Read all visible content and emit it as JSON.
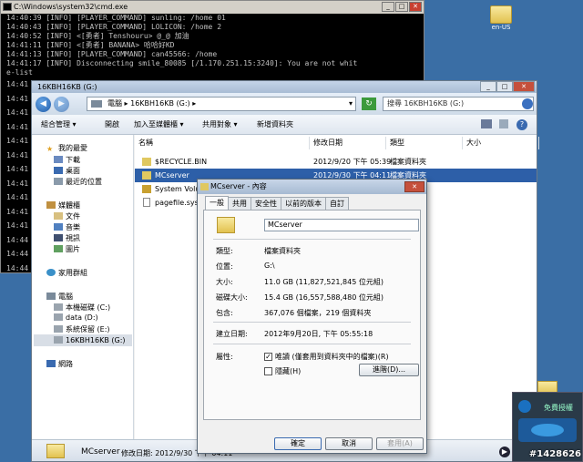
{
  "console": {
    "title": "C:\\Windows\\system32\\cmd.exe",
    "lines": [
      "14:40:39 [INFO] [PLAYER_COMMAND] sunling: /home 01",
      "14:40:43 [INFO] [PLAYER_COMMAND] LOLICON: /home 2",
      "14:40:52 [INFO] <[勇者] Tenshouru> @_@  加油",
      "14:41:11 [INFO] <[勇者] BANANA> 哈哈好KD",
      "14:41:13 [INFO] [PLAYER_COMMAND] can45566: /home",
      "14:41:17 [INFO] Disconnecting smile_80085 [/1.170.251.15:3240]: You are not whit",
      "e-list"
    ],
    "side_lines": [
      "14:41",
      "14:41",
      "14:41",
      "14:41",
      "14:41",
      "14:41",
      "14:41",
      "14:41",
      "14:41",
      "14:41",
      "14:41",
      "14:44",
      "14:44",
      "14:44"
    ]
  },
  "desktop": {
    "icon_label": "en-US"
  },
  "explorer": {
    "title": "16KBH16KB (G:)",
    "address": [
      "電腦",
      "16KBH16KB (G:)"
    ],
    "search_placeholder": "搜尋 16KBH16KB (G:)",
    "commands": [
      "組合管理 ▾",
      "開啟",
      "加入至媒體櫃 ▾",
      "共用對象 ▾",
      "新增資料夾"
    ],
    "nav": {
      "favorites": "我的最愛",
      "fav_items": [
        "下載",
        "桌面",
        "最近的位置"
      ],
      "libraries": "媒體櫃",
      "lib_items": [
        "文件",
        "音樂",
        "視訊",
        "圖片"
      ],
      "homegroup": "家用群組",
      "computer": "電腦",
      "drives": [
        "本機磁碟 (C:)",
        "data (D:)",
        "系統保留 (E:)",
        "16KBH16KB (G:)"
      ],
      "network": "網路"
    },
    "columns": [
      "名稱",
      "修改日期",
      "類型",
      "大小"
    ],
    "rows": [
      {
        "name": "$RECYCLE.BIN",
        "date": "2012/9/20 下午 05:39",
        "type": "檔案資料夾"
      },
      {
        "name": "MCserver",
        "date": "2012/9/30 下午 04:11",
        "type": "檔案資料夾"
      },
      {
        "name": "System Volu",
        "date": "",
        "type": ""
      },
      {
        "name": "pagefile.sys",
        "date": "",
        "type": ""
      }
    ],
    "status": {
      "name": "MCserver",
      "detail": "修改日期: 2012/9/30 下午 04:11"
    }
  },
  "props": {
    "title": "MCserver - 內容",
    "tabs": [
      "一般",
      "共用",
      "安全性",
      "以前的版本",
      "自訂"
    ],
    "name": "MCserver",
    "fields": [
      {
        "label": "類型:",
        "value": "檔案資料夾"
      },
      {
        "label": "位置:",
        "value": "G:\\"
      },
      {
        "label": "大小:",
        "value": "11.0 GB (11,827,521,845 位元組)"
      },
      {
        "label": "磁碟大小:",
        "value": "15.4 GB (16,557,588,480 位元組)"
      },
      {
        "label": "包含:",
        "value": "367,076 個檔案，219 個資料夾"
      },
      {
        "label": "建立日期:",
        "value": "2012年9月20日, 下午 05:55:18"
      }
    ],
    "attrs_label": "屬性:",
    "readonly": "唯讀 (僅套用到資料夾中的檔案)(R)",
    "hidden": "隱藏(H)",
    "advanced": "進階(D)...",
    "ok": "確定",
    "cancel": "取消",
    "apply": "套用(A)"
  },
  "teamviewer": {
    "label": "免費授權"
  },
  "watermark": "#1428626"
}
